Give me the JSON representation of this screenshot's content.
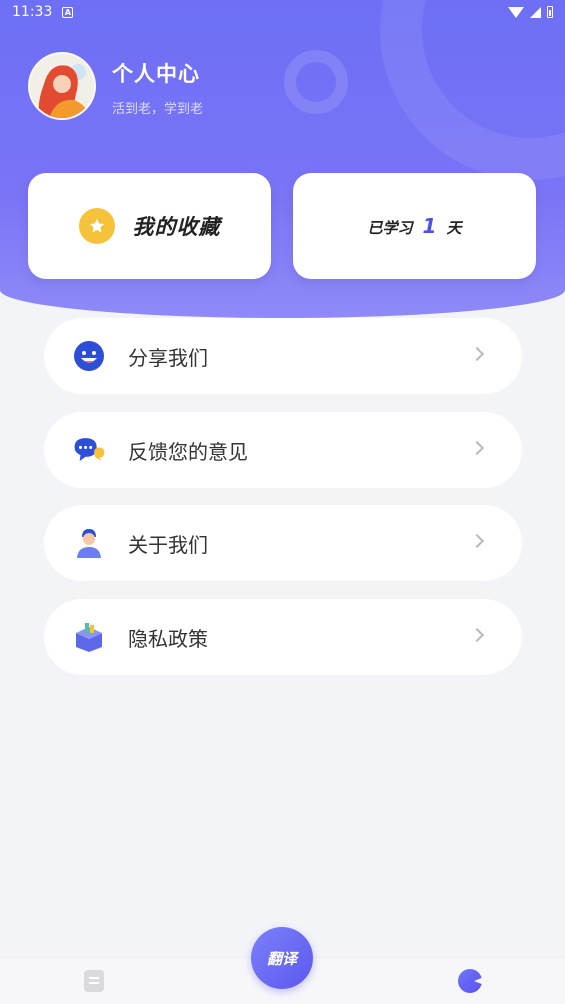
{
  "status_bar": {
    "time": "11:33",
    "badge": "A"
  },
  "profile": {
    "title": "个人中心",
    "subtitle": "活到老，学到老"
  },
  "cards": {
    "favorites_label": "我的收藏",
    "study_prefix": "已学习",
    "study_days": "1",
    "study_suffix": "天"
  },
  "menu": {
    "items": [
      {
        "label": "分享我们",
        "icon": "smile-face-icon"
      },
      {
        "label": "反馈您的意见",
        "icon": "chat-bubbles-icon"
      },
      {
        "label": "关于我们",
        "icon": "person-icon"
      },
      {
        "label": "隐私政策",
        "icon": "privacy-box-icon"
      }
    ]
  },
  "tabbar": {
    "center_label": "翻译",
    "left_icon": "document-icon",
    "right_icon": "pacman-icon"
  },
  "colors": {
    "accent": "#6d6ff5",
    "star": "#f5c23a",
    "study_number": "#4d52e8"
  }
}
